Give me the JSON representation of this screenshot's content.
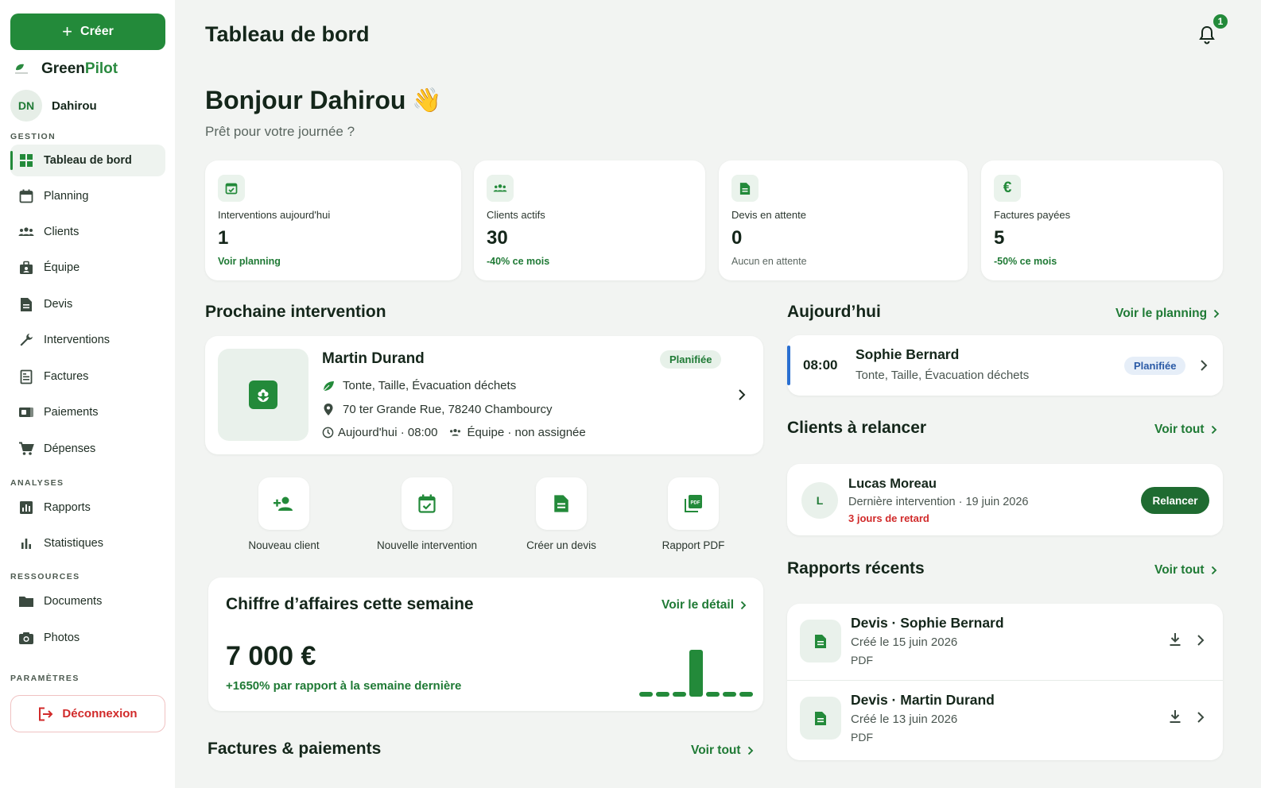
{
  "sidebar": {
    "create_label": "Créer",
    "brand_green": "Green",
    "brand_pilot": "Pilot",
    "user_initials": "DN",
    "user_name": "Dahirou",
    "sections": {
      "gestion": "GESTION",
      "analyses": "ANALYSES",
      "ressources": "RESSOURCES",
      "parametres": "PARAMÈTRES"
    },
    "items": [
      {
        "label": "Tableau de bord",
        "icon": "dashboard-icon"
      },
      {
        "label": "Planning",
        "icon": "calendar-icon"
      },
      {
        "label": "Clients",
        "icon": "people-icon"
      },
      {
        "label": "Équipe",
        "icon": "team-icon"
      },
      {
        "label": "Devis",
        "icon": "document-icon"
      },
      {
        "label": "Interventions",
        "icon": "wrench-icon"
      },
      {
        "label": "Factures",
        "icon": "invoice-icon"
      },
      {
        "label": "Paiements",
        "icon": "payment-icon"
      },
      {
        "label": "Dépenses",
        "icon": "cart-icon"
      },
      {
        "label": "Rapports",
        "icon": "report-icon"
      },
      {
        "label": "Statistiques",
        "icon": "stats-icon"
      },
      {
        "label": "Documents",
        "icon": "folder-icon"
      },
      {
        "label": "Photos",
        "icon": "camera-icon"
      }
    ],
    "logout_label": "Déconnexion"
  },
  "header": {
    "title": "Tableau de bord",
    "notifications": "1"
  },
  "greeting": {
    "title": "Bonjour Dahirou",
    "emoji": "👋",
    "subtitle": "Prêt pour votre journée ?"
  },
  "stats": [
    {
      "label": "Interventions aujourd'hui",
      "value": "1",
      "sub": "Voir planning"
    },
    {
      "label": "Clients actifs",
      "value": "30",
      "sub": "-40% ce mois"
    },
    {
      "label": "Devis en attente",
      "value": "0",
      "sub": "Aucun en attente"
    },
    {
      "label": "Factures payées",
      "value": "5",
      "sub": "-50% ce mois"
    }
  ],
  "next": {
    "section_title": "Prochaine intervention",
    "client": "Martin Durand",
    "status": "Planifiée",
    "services": "Tonte, Taille, Évacuation déchets",
    "address": "70 ter Grande Rue, 78240 Chambourcy",
    "when": "Aujourd'hui · 08:00",
    "team": "Équipe · non assignée"
  },
  "quick_actions": [
    {
      "label": "Nouveau client"
    },
    {
      "label": "Nouvelle intervention"
    },
    {
      "label": "Créer un devis"
    },
    {
      "label": "Rapport PDF"
    }
  ],
  "revenue": {
    "title": "Chiffre d’affaires cette semaine",
    "link": "Voir le détail",
    "value": "7 000 €",
    "comparison": "+1650% par rapport à la semaine dernière"
  },
  "chart_data": {
    "type": "bar",
    "values": [
      400,
      400,
      400,
      7000,
      400,
      400,
      400
    ]
  },
  "invoices": {
    "title": "Factures & paiements",
    "link": "Voir tout"
  },
  "today": {
    "title": "Aujourd’hui",
    "link": "Voir le planning",
    "time": "08:00",
    "client": "Sophie Bernard",
    "services": "Tonte, Taille, Évacuation déchets",
    "status": "Planifiée"
  },
  "relance": {
    "title": "Clients à relancer",
    "link": "Voir tout",
    "initial": "L",
    "client": "Lucas Moreau",
    "meta": "Dernière intervention · 19 juin 2026",
    "late": "3 jours de retard",
    "button": "Relancer"
  },
  "reports": {
    "title": "Rapports récents",
    "link": "Voir tout",
    "items": [
      {
        "title": "Devis · Sophie Bernard",
        "date": "Créé le 15 juin 2026",
        "type": "PDF"
      },
      {
        "title": "Devis · Martin Durand",
        "date": "Créé le 13 juin 2026",
        "type": "PDF"
      }
    ]
  },
  "colors": {
    "accent": "#238a3a",
    "danger": "#d12a2a",
    "info": "#2a6fd1"
  }
}
